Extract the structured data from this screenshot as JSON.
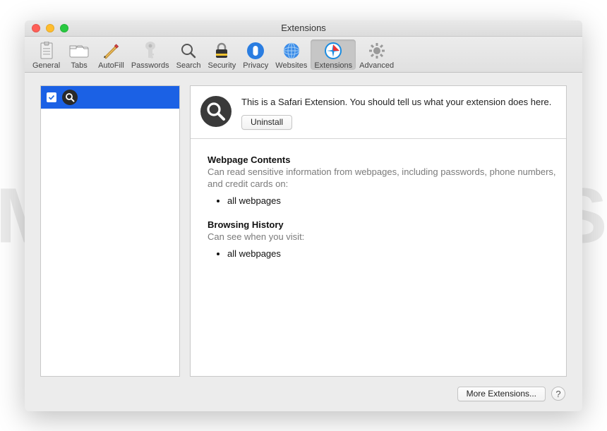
{
  "watermark": "MALWARETIPS",
  "window_title": "Extensions",
  "toolbar": [
    {
      "id": "general",
      "label": "General"
    },
    {
      "id": "tabs",
      "label": "Tabs"
    },
    {
      "id": "autofill",
      "label": "AutoFill"
    },
    {
      "id": "passwords",
      "label": "Passwords"
    },
    {
      "id": "search",
      "label": "Search"
    },
    {
      "id": "security",
      "label": "Security"
    },
    {
      "id": "privacy",
      "label": "Privacy"
    },
    {
      "id": "websites",
      "label": "Websites"
    },
    {
      "id": "extensions",
      "label": "Extensions",
      "selected": true
    },
    {
      "id": "advanced",
      "label": "Advanced"
    }
  ],
  "extension": {
    "description": "This is a Safari Extension. You should tell us what your extension does here.",
    "uninstall_label": "Uninstall"
  },
  "permissions": {
    "webpage_title": "Webpage Contents",
    "webpage_sub": "Can read sensitive information from webpages, including passwords, phone numbers, and credit cards on:",
    "webpage_items": [
      "all webpages"
    ],
    "browsing_title": "Browsing History",
    "browsing_sub": "Can see when you visit:",
    "browsing_items": [
      "all webpages"
    ]
  },
  "footer": {
    "more_extensions": "More Extensions...",
    "help": "?"
  }
}
